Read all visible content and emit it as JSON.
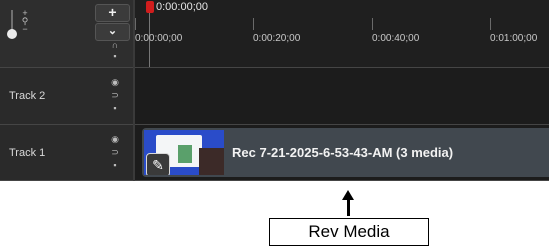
{
  "header": {
    "add_label": "+",
    "more_label": "⌄"
  },
  "ruler": {
    "playhead_time": "0:00:00;00",
    "ticks": [
      "0:00:00;00",
      "0:00:20;00",
      "0:00:40;00",
      "0:01:00;00"
    ]
  },
  "tracks": [
    {
      "label": "Track 2"
    },
    {
      "label": "Track 1"
    }
  ],
  "clip": {
    "title": "Rec 7-21-2025-6-53-43-AM  (3 media)"
  },
  "annotation": {
    "callout_label": "Rev Media"
  },
  "colors": {
    "playhead": "#d11d1d",
    "clip_bg": "#41484f",
    "timeline_bg": "#1b1b1b"
  },
  "icons": [
    "zoom-slider-icon",
    "zoom-magnifier-icon",
    "eye-icon",
    "magnet-icon",
    "lock-icon",
    "pencil-icon",
    "arrow-up-icon"
  ]
}
